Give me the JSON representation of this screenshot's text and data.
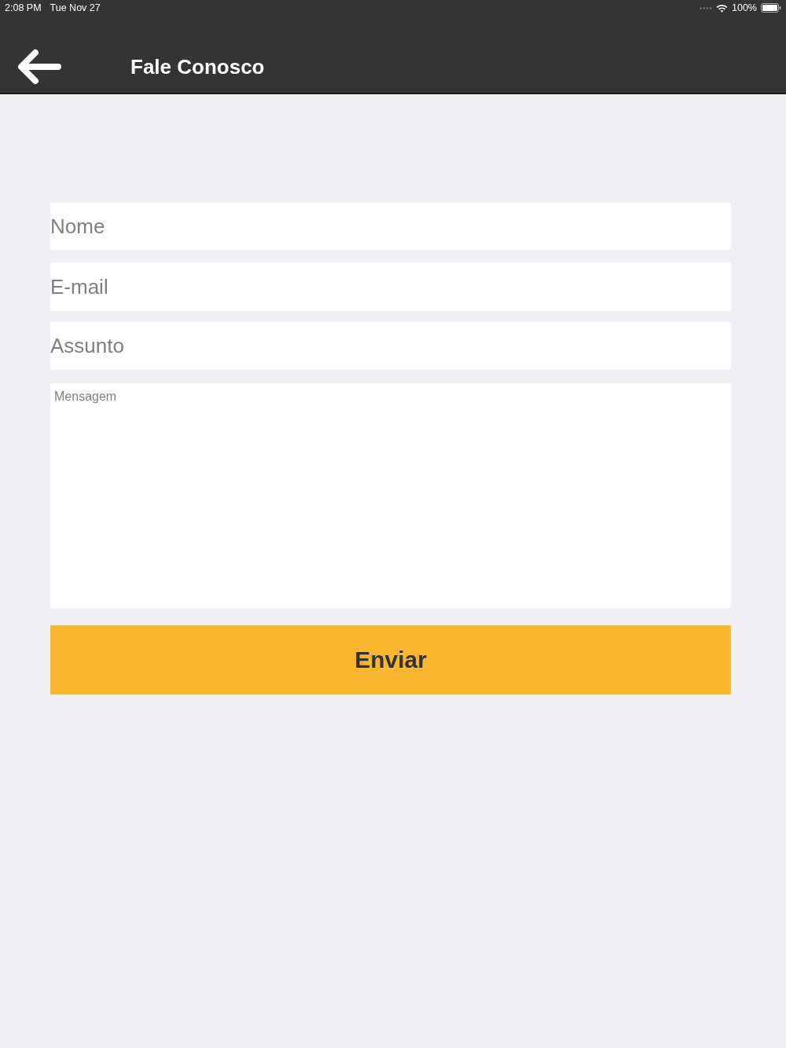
{
  "status_bar": {
    "time": "2:08 PM",
    "date": "Tue Nov 27",
    "battery": "100%"
  },
  "header": {
    "title": "Fale Conosco"
  },
  "form": {
    "fields": [
      {
        "kind": "input",
        "placeholder": "Nome"
      },
      {
        "kind": "input",
        "placeholder": "E-mail"
      },
      {
        "kind": "input",
        "placeholder": "Assunto"
      },
      {
        "kind": "textarea",
        "placeholder": "Mensagem"
      }
    ],
    "submit": "Enviar"
  }
}
